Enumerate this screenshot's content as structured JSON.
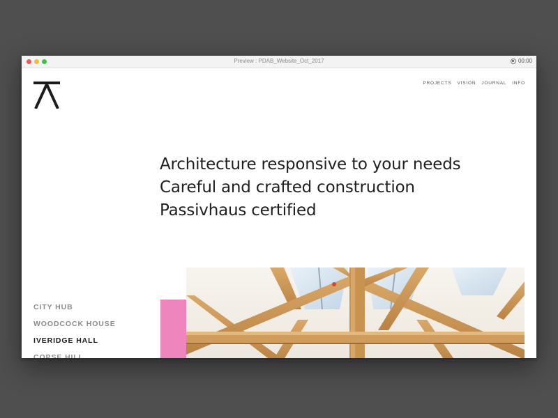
{
  "window": {
    "title": "Preview : PDAB_Website_Oct_2017",
    "record_time": "00:00"
  },
  "site": {
    "logo_icon": "pdab-logo-icon",
    "nav": [
      {
        "label": "PROJECTS"
      },
      {
        "label": "VISION"
      },
      {
        "label": "JOURNAL"
      },
      {
        "label": "INFO"
      }
    ],
    "headline": [
      "Architecture responsive to your needs",
      "Careful and crafted construction",
      "Passivhaus certified"
    ],
    "projects": [
      {
        "label": "CITY HUB",
        "active": false
      },
      {
        "label": "WOODCOCK HOUSE",
        "active": false
      },
      {
        "label": "IVERIDGE HALL",
        "active": true
      },
      {
        "label": "COPSE HILL",
        "active": false
      }
    ]
  },
  "colors": {
    "accent_pink": "#ee86bd",
    "text_dark": "#1f1f1f",
    "text_muted": "#8c8c8c",
    "background": "#4f4f4f"
  }
}
